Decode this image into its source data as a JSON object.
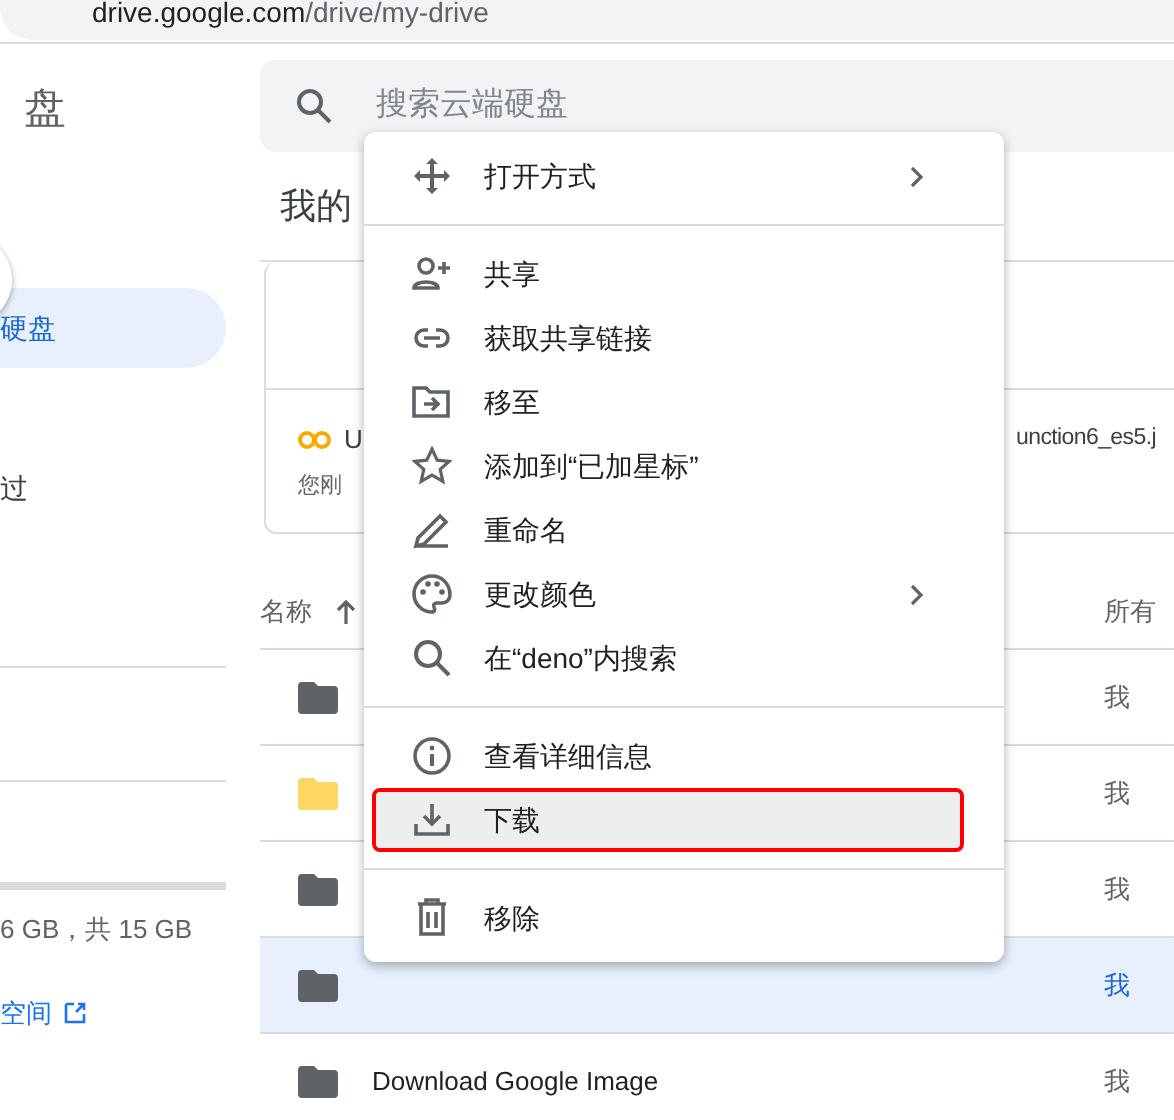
{
  "address_bar": {
    "host": "drive.google.com",
    "path": "/drive/my-drive"
  },
  "sidebar": {
    "title": "盘",
    "nav": [
      {
        "label": "硬盘",
        "selected": true
      },
      {
        "label": "过",
        "selected": false
      }
    ],
    "storage_text": "6 GB，共 15 GB",
    "storage_link": "空间"
  },
  "search": {
    "placeholder": "搜索云端硬盘"
  },
  "heading": "我的",
  "suggested": [
    {
      "name": "U",
      "subtitle": "您刚"
    },
    {
      "name": "unction6_es5.j"
    }
  ],
  "table": {
    "columns": [
      "名称",
      "所有"
    ],
    "rows": [
      {
        "owner": "我",
        "color": "#5f6368",
        "selected": false
      },
      {
        "owner": "我",
        "color": "#fdd663",
        "selected": false
      },
      {
        "owner": "我",
        "color": "#5f6368",
        "selected": false
      },
      {
        "owner": "我",
        "color": "#5f6368",
        "selected": true
      },
      {
        "name": "Download Google Image",
        "owner": "我",
        "color": "#5f6368",
        "selected": false
      }
    ]
  },
  "context_menu": [
    {
      "label": "打开方式",
      "submenu": true,
      "divider_after": true,
      "highlighted": false
    },
    {
      "label": "共享",
      "submenu": false,
      "divider_after": false,
      "highlighted": false
    },
    {
      "label": "获取共享链接",
      "submenu": false,
      "divider_after": false,
      "highlighted": false
    },
    {
      "label": "移至",
      "submenu": false,
      "divider_after": false,
      "highlighted": false
    },
    {
      "label": "添加到“已加星标”",
      "submenu": false,
      "divider_after": false,
      "highlighted": false
    },
    {
      "label": "重命名",
      "submenu": false,
      "divider_after": false,
      "highlighted": false
    },
    {
      "label": "更改颜色",
      "submenu": true,
      "divider_after": false,
      "highlighted": false
    },
    {
      "label": "在“deno”内搜索",
      "submenu": false,
      "divider_after": true,
      "highlighted": false
    },
    {
      "label": "查看详细信息",
      "submenu": false,
      "divider_after": false,
      "highlighted": false
    },
    {
      "label": "下载",
      "submenu": false,
      "divider_after": true,
      "highlighted": true
    },
    {
      "label": "移除",
      "submenu": false,
      "divider_after": false,
      "highlighted": false
    }
  ]
}
